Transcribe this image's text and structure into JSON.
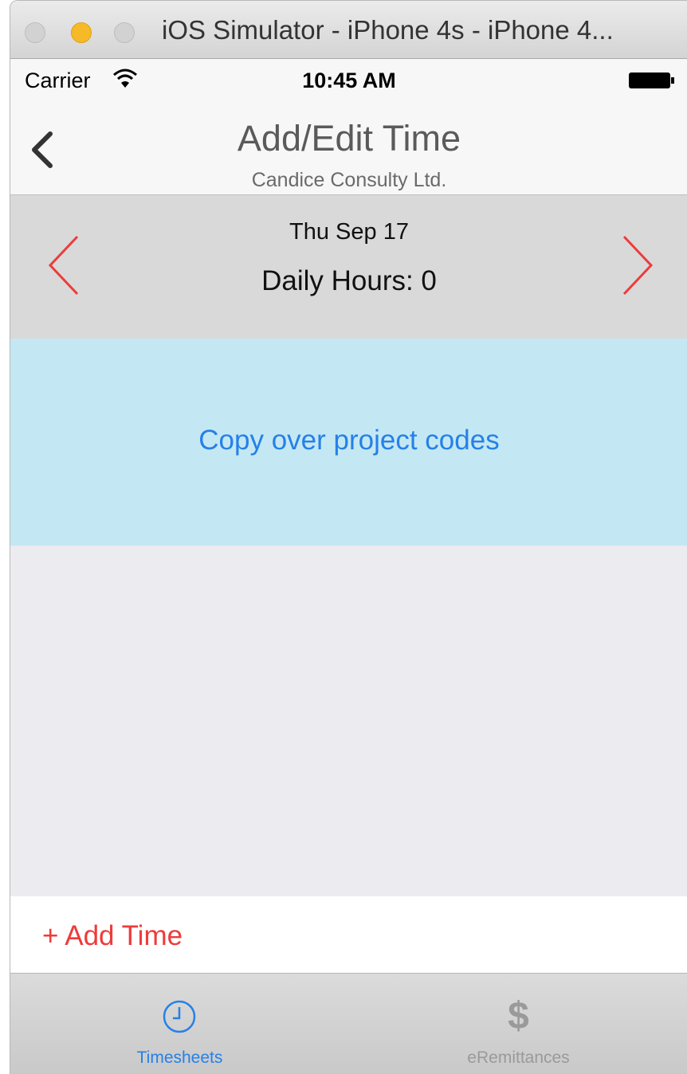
{
  "window": {
    "title": "iOS Simulator - iPhone 4s - iPhone 4..."
  },
  "status_bar": {
    "carrier": "Carrier",
    "time": "10:45 AM"
  },
  "nav": {
    "title": "Add/Edit Time",
    "subtitle": "Candice Consulty Ltd."
  },
  "day": {
    "date": "Thu Sep 17",
    "daily_hours": "Daily Hours: 0"
  },
  "copy_codes": {
    "label": "Copy over project codes"
  },
  "add_time": {
    "label": "+ Add Time"
  },
  "tabs": [
    {
      "label": "Timesheets",
      "icon": "clock-icon",
      "selected": true
    },
    {
      "label": "eRemittances",
      "icon": "dollar-icon",
      "selected": false
    }
  ],
  "colors": {
    "accent_blue": "#2680e8",
    "arrow_red": "#ee3b3b",
    "copy_band_bg": "#c4e8f3",
    "date_band_bg": "#d9d9d9"
  }
}
